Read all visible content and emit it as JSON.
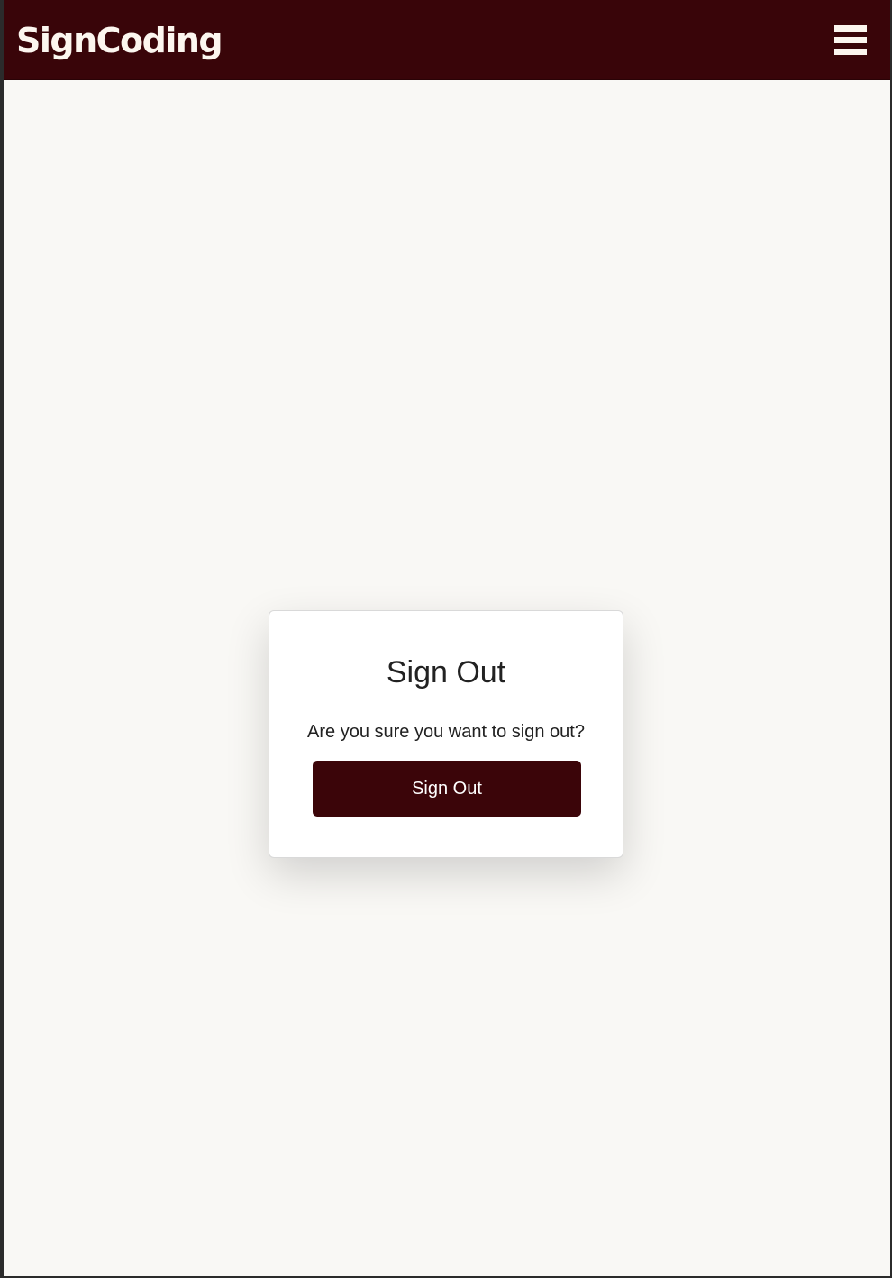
{
  "header": {
    "brand": "SignCoding",
    "menu_icon": "hamburger-menu-icon"
  },
  "signout_card": {
    "title": "Sign Out",
    "message": "Are you sure you want to sign out?",
    "button_label": "Sign Out"
  },
  "colors": {
    "navbar": "#390509",
    "brand_text": "#fcf6ef",
    "page_background": "#f9f8f5",
    "card_background": "#ffffff",
    "button_background": "#3b0509",
    "button_text": "#ffffff",
    "text": "#222222"
  }
}
